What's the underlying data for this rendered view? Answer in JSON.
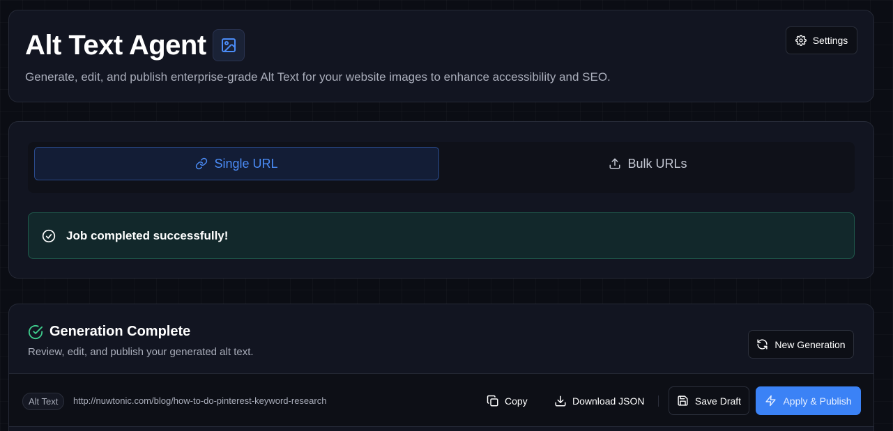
{
  "header": {
    "title": "Alt Text Agent",
    "title_icon": "image-icon",
    "subtitle": "Generate, edit, and publish enterprise-grade Alt Text for your website images to enhance accessibility and SEO.",
    "settings_label": "Settings",
    "settings_icon": "gear-icon"
  },
  "mode_tabs": {
    "single_label": "Single URL",
    "single_icon": "link-icon",
    "bulk_label": "Bulk URLs",
    "bulk_icon": "upload-icon",
    "active": "single"
  },
  "alert": {
    "text": "Job completed successfully!",
    "icon": "check-circle-icon"
  },
  "results": {
    "title": "Generation Complete",
    "subtitle": "Review, edit, and publish your generated alt text.",
    "new_generation_label": "New Generation",
    "toolbar": {
      "tag": "Alt Text",
      "url": "http://nuwtonic.com/blog/how-to-do-pinterest-keyword-research",
      "copy_label": "Copy",
      "download_label": "Download JSON",
      "save_draft_label": "Save Draft",
      "publish_label": "Apply & Publish"
    }
  },
  "colors": {
    "accent": "#3b82f6",
    "success": "#3fcf8e",
    "background": "#0b0d14",
    "card": "#121521"
  }
}
